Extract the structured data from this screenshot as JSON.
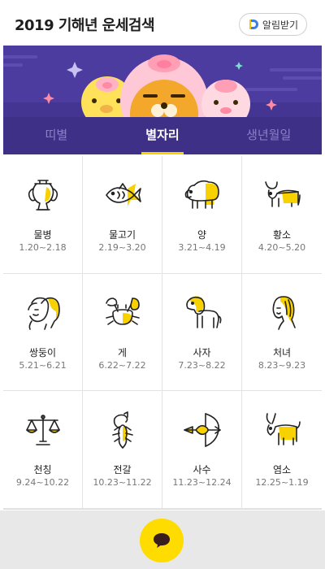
{
  "header": {
    "title": "2019 기해년 운세검색",
    "alert_label": "알림받기"
  },
  "tabs": [
    {
      "label": "띠별",
      "active": false
    },
    {
      "label": "별자리",
      "active": true
    },
    {
      "label": "생년월일",
      "active": false
    }
  ],
  "signs": [
    {
      "name": "물병",
      "dates": "1.20~2.18",
      "icon": "aquarius-icon"
    },
    {
      "name": "물고기",
      "dates": "2.19~3.20",
      "icon": "pisces-icon"
    },
    {
      "name": "양",
      "dates": "3.21~4.19",
      "icon": "aries-icon"
    },
    {
      "name": "황소",
      "dates": "4.20~5.20",
      "icon": "taurus-icon"
    },
    {
      "name": "쌍둥이",
      "dates": "5.21~6.21",
      "icon": "gemini-icon"
    },
    {
      "name": "게",
      "dates": "6.22~7.22",
      "icon": "cancer-icon"
    },
    {
      "name": "사자",
      "dates": "7.23~8.22",
      "icon": "leo-icon"
    },
    {
      "name": "처녀",
      "dates": "8.23~9.23",
      "icon": "virgo-icon"
    },
    {
      "name": "천칭",
      "dates": "9.24~10.22",
      "icon": "libra-icon"
    },
    {
      "name": "전갈",
      "dates": "10.23~11.22",
      "icon": "scorpio-icon"
    },
    {
      "name": "사수",
      "dates": "11.23~12.24",
      "icon": "sagittarius-icon"
    },
    {
      "name": "염소",
      "dates": "12.25~1.19",
      "icon": "capricorn-icon"
    }
  ],
  "colors": {
    "accent": "#fedc00",
    "banner": "#4d3c9f",
    "tabbar": "#3e2f87",
    "icon_fill": "#f8d100"
  },
  "fab_icon": "chat-bubble-icon"
}
